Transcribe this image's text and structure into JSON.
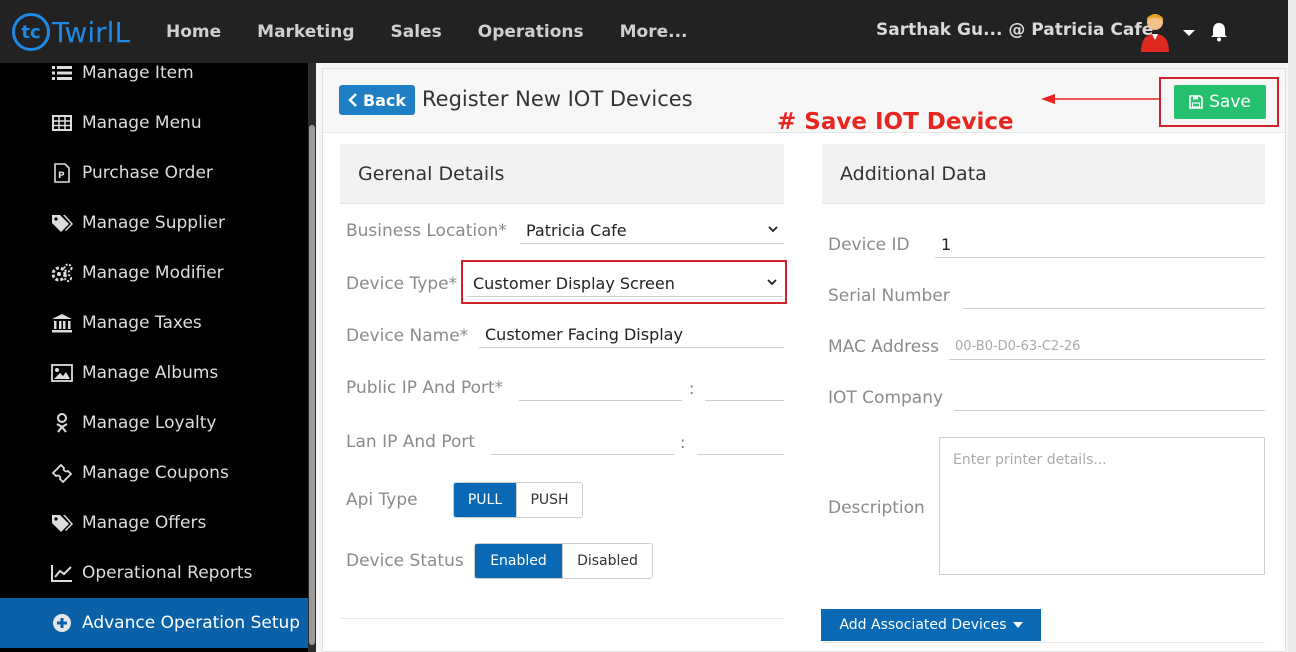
{
  "brand": {
    "name": "TwirlL",
    "color": "#1e88e5"
  },
  "nav": [
    "Home",
    "Marketing",
    "Sales",
    "Operations",
    "More..."
  ],
  "user": {
    "text": "Sarthak Gu...  @ Patricia Cafe"
  },
  "sidebar": {
    "items": [
      {
        "label": "Manage Item",
        "icon": "list-icon"
      },
      {
        "label": "Manage Menu",
        "icon": "table-icon"
      },
      {
        "label": "Purchase Order",
        "icon": "document-icon"
      },
      {
        "label": "Manage Supplier",
        "icon": "tags-icon"
      },
      {
        "label": "Manage Modifier",
        "icon": "gears-icon"
      },
      {
        "label": "Manage Taxes",
        "icon": "bank-icon"
      },
      {
        "label": "Manage Albums",
        "icon": "image-icon"
      },
      {
        "label": "Manage Loyalty",
        "icon": "loyalty-icon"
      },
      {
        "label": "Manage Coupons",
        "icon": "ticket-icon"
      },
      {
        "label": "Manage Offers",
        "icon": "tags-icon"
      },
      {
        "label": "Operational Reports",
        "icon": "chart-line-icon"
      },
      {
        "label": "Advance Operation Setup",
        "icon": "plus-circle-icon"
      }
    ],
    "active_color": "#0a61a8"
  },
  "header": {
    "back_label": "Back",
    "title": "Register New IOT Devices",
    "save_label": "Save",
    "annotation": "# Save IOT Device",
    "save_color": "#25c16f",
    "annotation_color": "#e8261f"
  },
  "general": {
    "title": "Gerenal Details",
    "business_location_label": "Business Location*",
    "business_location_value": "Patricia Cafe",
    "device_type_label": "Device Type*",
    "device_type_value": "Customer Display Screen",
    "device_name_label": "Device Name*",
    "device_name_value": "Customer Facing Display",
    "public_ip_label": "Public IP And Port*",
    "lan_ip_label": "Lan IP And Port",
    "colon": ":",
    "api_type_label": "Api Type",
    "api_options": [
      "PULL",
      "PUSH"
    ],
    "device_status_label": "Device Status",
    "status_options": [
      "Enabled",
      "Disabled"
    ]
  },
  "additional": {
    "title": "Additional Data",
    "device_id_label": "Device ID",
    "device_id_value": "1",
    "serial_label": "Serial Number",
    "mac_label": "MAC Address",
    "mac_placeholder": "00-B0-D0-63-C2-26",
    "iot_company_label": "IOT Company",
    "description_label": "Description",
    "description_placeholder": "Enter printer details...",
    "assoc_label": "Add Associated Devices"
  }
}
